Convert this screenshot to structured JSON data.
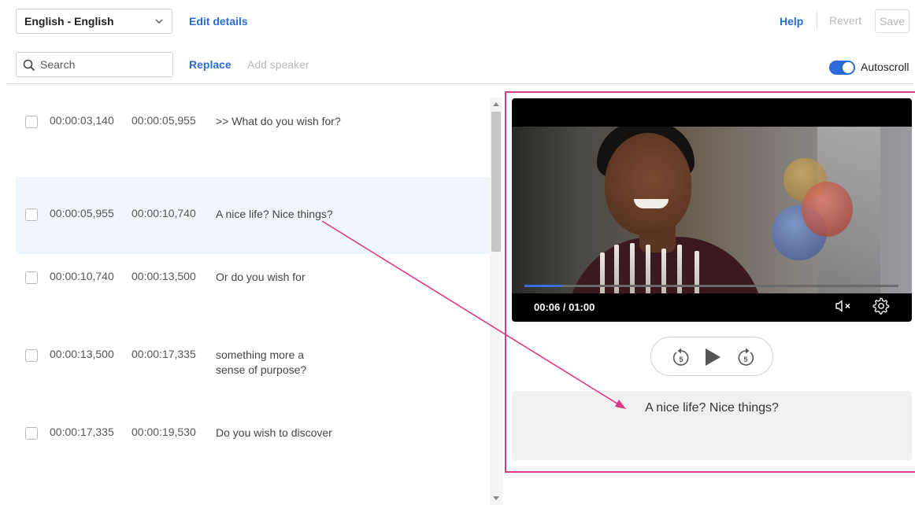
{
  "toolbar": {
    "language": "English - English",
    "edit_details": "Edit details",
    "help": "Help",
    "revert": "Revert",
    "save": "Save",
    "search_placeholder": "Search",
    "replace": "Replace",
    "add_speaker": "Add speaker",
    "autoscroll": "Autoscroll",
    "autoscroll_on": true
  },
  "captions": [
    {
      "start": "00:00:03,140",
      "end": "00:00:05,955",
      "lines": [
        ">> What do you wish for?"
      ],
      "active": false
    },
    {
      "start": "00:00:05,955",
      "end": "00:00:10,740",
      "lines": [
        "A nice life? Nice things?"
      ],
      "active": true
    },
    {
      "start": "00:00:10,740",
      "end": "00:00:13,500",
      "lines": [
        "Or do you wish for"
      ],
      "active": false
    },
    {
      "start": "00:00:13,500",
      "end": "00:00:17,335",
      "lines": [
        "something more a",
        "sense of purpose?"
      ],
      "active": false
    },
    {
      "start": "00:00:17,335",
      "end": "00:00:19,530",
      "lines": [
        "Do you wish to discover"
      ],
      "active": false
    }
  ],
  "player": {
    "timecode": "00:06 / 01:00",
    "progress": 0.1,
    "caption_preview": "A nice life? Nice things?",
    "icons": [
      "mute-icon",
      "settings-gear-icon",
      "rewind-5-icon",
      "play-icon",
      "forward-5-icon"
    ]
  },
  "colors": {
    "accent": "#2c6bd6",
    "highlight_frame": "#d93a83",
    "active_row": "#f1f6fd"
  }
}
